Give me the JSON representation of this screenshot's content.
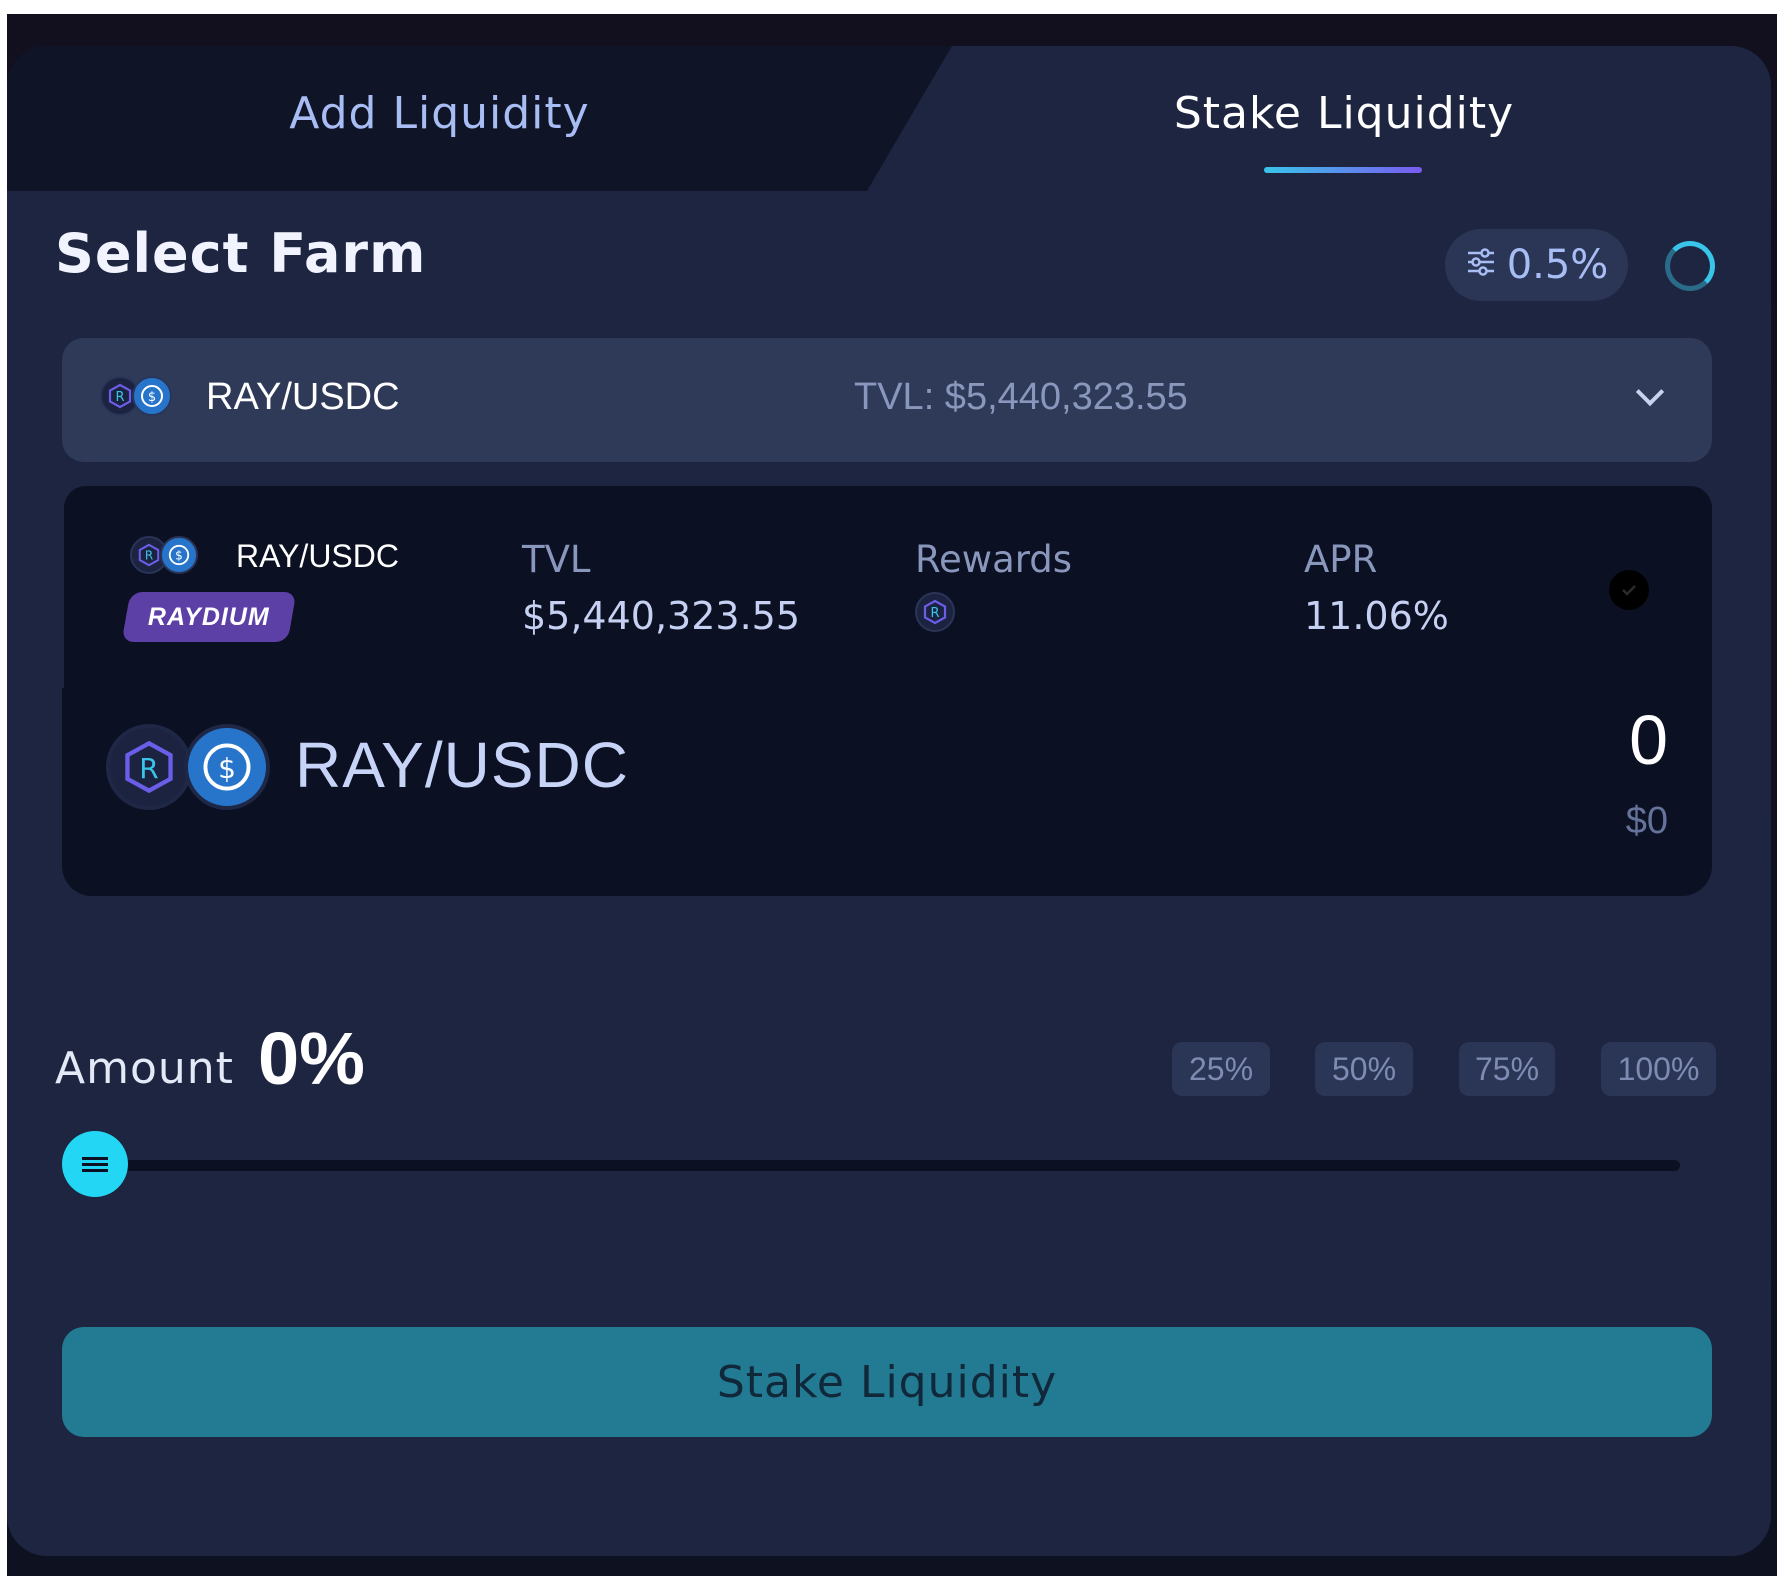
{
  "tabs": [
    {
      "label": "Add Liquidity",
      "active": false
    },
    {
      "label": "Stake Liquidity",
      "active": true
    }
  ],
  "header": {
    "title": "Select Farm",
    "slippage": "0.5%"
  },
  "selector": {
    "pair": "RAY/USDC",
    "tvl": "TVL: $5,440,323.55"
  },
  "farm": {
    "pair": "RAY/USDC",
    "badge": "RAYDIUM",
    "tvl_label": "TVL",
    "tvl_value": "$5,440,323.55",
    "rewards_label": "Rewards",
    "apr_label": "APR",
    "apr_value": "11.06%",
    "selected": true
  },
  "amount_box": {
    "pair": "RAY/USDC",
    "value": "0",
    "usd": "$0"
  },
  "amount": {
    "label": "Amount",
    "percent": "0%",
    "percent_value": 0,
    "presets": [
      "25%",
      "50%",
      "75%",
      "100%"
    ]
  },
  "action": {
    "label": "Stake Liquidity"
  },
  "colors": {
    "accent": "#23d6f3",
    "button": "#237a93",
    "badge": "#5c40a5"
  },
  "icons": {
    "ray": "raydium-token-icon",
    "usdc": "usdc-token-icon"
  }
}
